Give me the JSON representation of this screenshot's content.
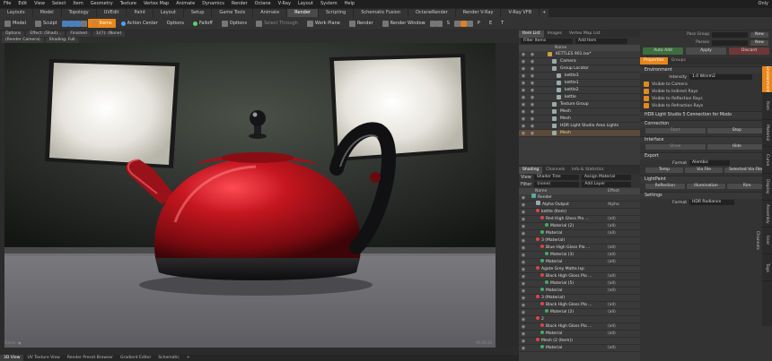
{
  "menubar": {
    "items": [
      "File",
      "Edit",
      "View",
      "Select",
      "Item",
      "Geometry",
      "Texture",
      "Vertex Map",
      "Animate",
      "Dynamics",
      "Render",
      "Octane",
      "V-Ray",
      "Layout",
      "System",
      "Help"
    ],
    "right": "Only"
  },
  "layout_tabs": [
    {
      "label": "Layouts"
    },
    {
      "label": "Model"
    },
    {
      "label": "Topology"
    },
    {
      "label": "UVEdit"
    },
    {
      "label": "Paint"
    },
    {
      "label": "Layout"
    },
    {
      "label": "Setup"
    },
    {
      "label": "Game Tools"
    },
    {
      "label": "Animate"
    },
    {
      "label": "Render",
      "active": true
    },
    {
      "label": "Scripting"
    },
    {
      "label": "Schematic Fusion"
    },
    {
      "label": "OctaneRender"
    },
    {
      "label": "Render V-Ray"
    },
    {
      "label": "V-Ray VFB"
    },
    {
      "label": "+"
    }
  ],
  "toolbar": {
    "model": "Model",
    "sculpt": "Sculpt",
    "items": "Items",
    "action_center": "Action Center",
    "options1": "Options",
    "falloff": "Falloff",
    "options2": "Options",
    "select_through": "Select Through",
    "work_plane": "Work Plane",
    "render": "Render",
    "render_window": "Render Window",
    "letters": [
      "S",
      "P",
      "E",
      "T"
    ]
  },
  "viewport_header": {
    "row1": [
      "Options",
      "Effect: (Shad)...",
      "Finished",
      "1/(?): (None)"
    ],
    "row2": [
      "(Render Camera)",
      "Shading: Full"
    ]
  },
  "bottom_tabs": [
    {
      "label": "3D View",
      "active": true
    },
    {
      "label": "UV Texture View"
    },
    {
      "label": "Render Preset Browser"
    },
    {
      "label": "Gradient Editor"
    },
    {
      "label": "Schematic"
    },
    {
      "label": "+"
    }
  ],
  "item_list": {
    "tabs": [
      {
        "label": "Item List",
        "active": true
      },
      {
        "label": "Images"
      },
      {
        "label": "Vertex Map List"
      }
    ],
    "filter": "Filter Items",
    "add_item": "Add Item",
    "header": "Name",
    "rows": [
      {
        "label": "KETTLES 901.lxo*",
        "indent": 0
      },
      {
        "label": "Camera",
        "indent": 1
      },
      {
        "label": "Group Locator",
        "indent": 1
      },
      {
        "label": "kettle3",
        "indent": 2
      },
      {
        "label": "kettle1",
        "indent": 2
      },
      {
        "label": "kettle2",
        "indent": 2
      },
      {
        "label": "kettle",
        "indent": 2
      },
      {
        "label": "Texture Group",
        "indent": 1
      },
      {
        "label": "Mesh",
        "indent": 1
      },
      {
        "label": "Mesh",
        "indent": 1
      },
      {
        "label": "HDR Light Studio Area Lights",
        "indent": 1
      },
      {
        "label": "Mesh",
        "indent": 1,
        "selected": true
      }
    ]
  },
  "shading": {
    "tabs": [
      {
        "label": "Shading",
        "active": true
      },
      {
        "label": "Channels"
      },
      {
        "label": "Info & Statistics"
      }
    ],
    "view_label": "View",
    "view_value": "Shader Tree",
    "assign": "Assign Material",
    "filter_label": "Filter",
    "filter_value": "(none)",
    "add_layer": "Add Layer",
    "header_name": "Name",
    "header_effect": "Effect",
    "rows": [
      {
        "name": "Render",
        "effect": "",
        "indent": 0,
        "kind": "render"
      },
      {
        "name": "Alpha Output",
        "effect": "Alpha",
        "indent": 1,
        "kind": "plain"
      },
      {
        "name": "kettle (Item)",
        "effect": "",
        "indent": 1,
        "kind": "group"
      },
      {
        "name": "Red High Gloss Pla ...",
        "effect": "(all)",
        "indent": 2,
        "kind": "mat"
      },
      {
        "name": "Material (2)",
        "effect": "(all)",
        "indent": 3,
        "kind": "sub"
      },
      {
        "name": "Material",
        "effect": "(all)",
        "indent": 2,
        "kind": "sub"
      },
      {
        "name": "3 (Material)",
        "effect": "",
        "indent": 1,
        "kind": "group"
      },
      {
        "name": "Blue High Gloss Pla ...",
        "effect": "(all)",
        "indent": 2,
        "kind": "mat"
      },
      {
        "name": "Material (3)",
        "effect": "(all)",
        "indent": 3,
        "kind": "sub"
      },
      {
        "name": "Material",
        "effect": "(all)",
        "indent": 2,
        "kind": "sub"
      },
      {
        "name": "Agate Grey Matte.lxp",
        "effect": "",
        "indent": 1,
        "kind": "group"
      },
      {
        "name": "Black High Gloss Pla ...",
        "effect": "(all)",
        "indent": 2,
        "kind": "mat"
      },
      {
        "name": "Material (5)",
        "effect": "(all)",
        "indent": 3,
        "kind": "sub"
      },
      {
        "name": "Material",
        "effect": "(all)",
        "indent": 2,
        "kind": "sub"
      },
      {
        "name": "3 (Material)",
        "effect": "",
        "indent": 1,
        "kind": "group"
      },
      {
        "name": "Black High Gloss Pla ...",
        "effect": "(all)",
        "indent": 2,
        "kind": "mat"
      },
      {
        "name": "Material (2)",
        "effect": "(all)",
        "indent": 3,
        "kind": "sub"
      },
      {
        "name": "2",
        "effect": "",
        "indent": 1,
        "kind": "group"
      },
      {
        "name": "Black High Gloss Pla ...",
        "effect": "(all)",
        "indent": 2,
        "kind": "mat"
      },
      {
        "name": "Material",
        "effect": "(all)",
        "indent": 2,
        "kind": "sub"
      },
      {
        "name": "Mesh (2 (Item))",
        "effect": "",
        "indent": 1,
        "kind": "group"
      },
      {
        "name": "Material",
        "effect": "(all)",
        "indent": 2,
        "kind": "sub"
      }
    ]
  },
  "right_panel": {
    "pass_group_label": "Pass Group",
    "pass_group_new": "New",
    "passes_label": "Passes",
    "passes_new": "New",
    "auto_add": "Auto Add",
    "apply": "Apply",
    "discard": "Discard",
    "tabs": [
      {
        "label": "Properties",
        "active": true
      },
      {
        "label": "Groups"
      }
    ],
    "environment": "Environment",
    "intensity_label": "Intensity",
    "intensity_value": "1.0 W/srm2",
    "checks": [
      "Visible to Camera",
      "Visible to Indirect Rays",
      "Visible to Reflection Rays",
      "Visible to Refraction Rays"
    ],
    "hdr_connection": "HDR Light Studio 5 Connection for Modo",
    "connection": "Connection",
    "start": "Start",
    "stop": "Stop",
    "interface": "Interface",
    "show": "Show",
    "hide": "Hide",
    "export": "Export",
    "format_label": "Format",
    "format_value": "Alembic",
    "temp": "Temp",
    "via_file": "Via File",
    "selected_via_file": "Selected Via File",
    "lightpaint": "LightPaint",
    "reflection": "Reflection",
    "illumination": "Illumination",
    "rim": "Rim",
    "settings": "Settings",
    "settings_format_label": "Format",
    "settings_format_value": "HDR Radiance"
  },
  "vtabs": [
    {
      "label": "Environment",
      "active": true
    },
    {
      "label": "Item"
    },
    {
      "label": "Material"
    },
    {
      "label": "Curve"
    },
    {
      "label": "Display"
    },
    {
      "label": "Assembly"
    },
    {
      "label": "User Channels"
    },
    {
      "label": "Tags"
    }
  ],
  "colors": {
    "accent": "#e8861a",
    "kettle": "#b5121b",
    "floor": "#6f6f72"
  }
}
